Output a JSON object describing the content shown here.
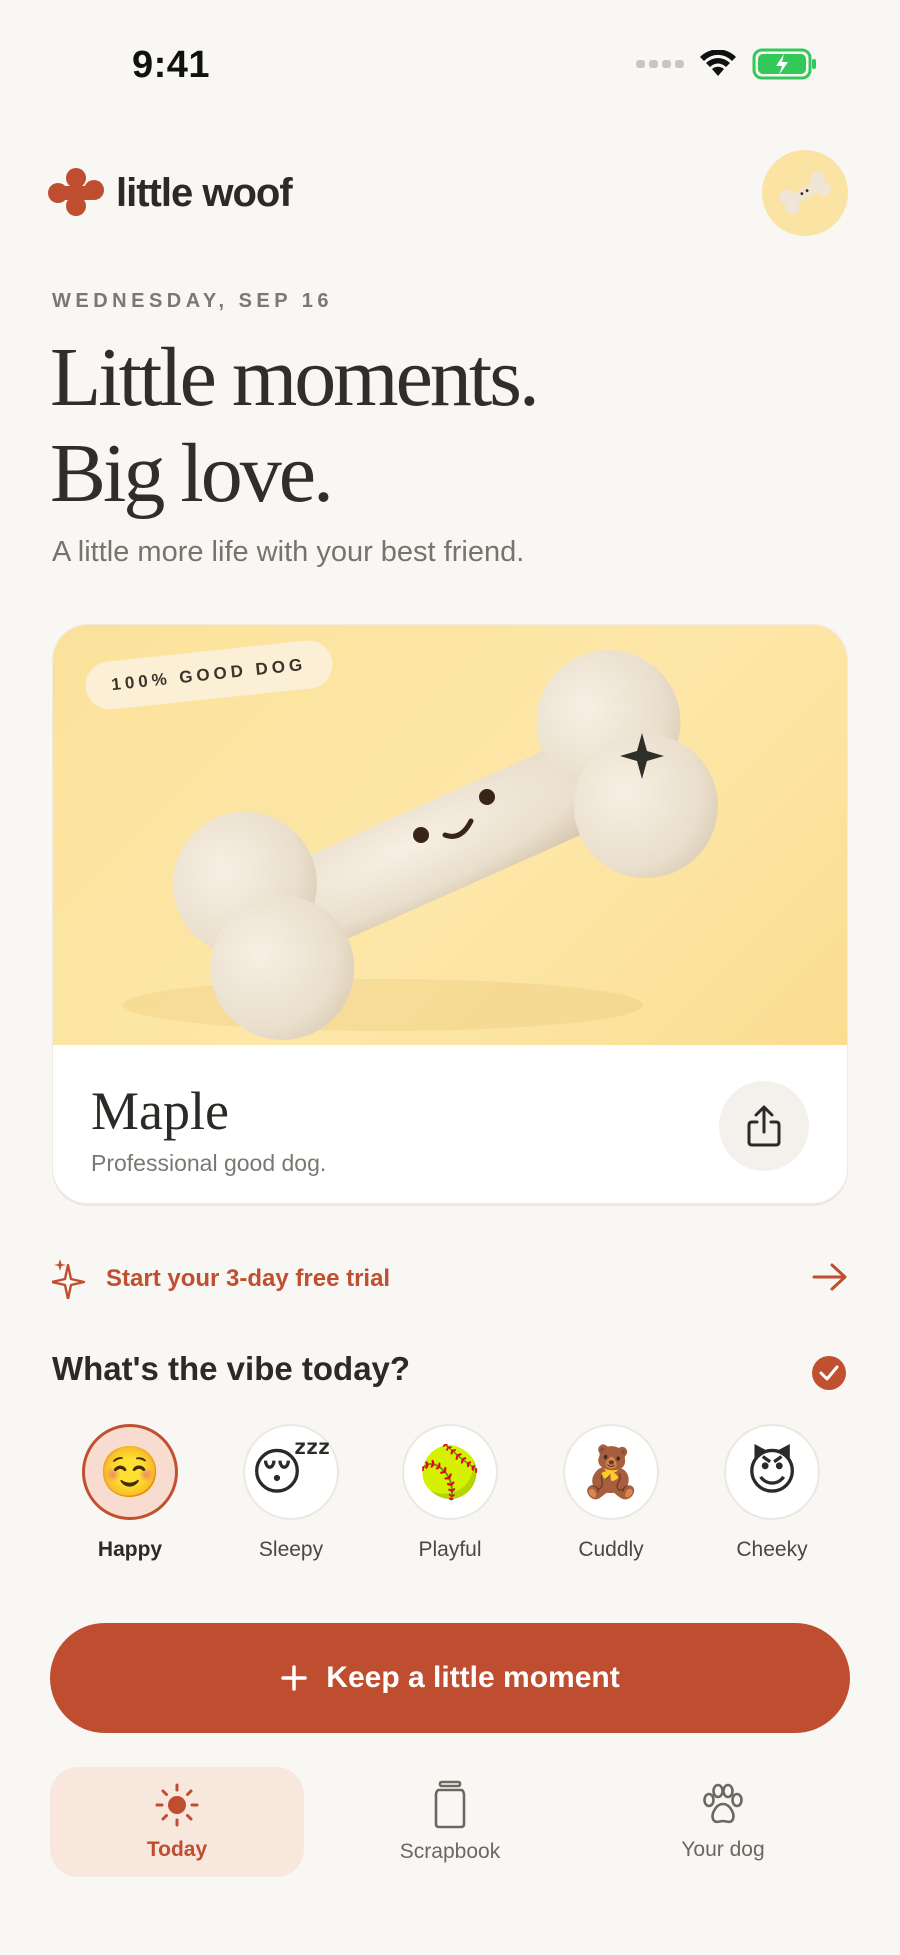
{
  "status_bar": {
    "time": "9:41"
  },
  "brand": {
    "name": "little woof"
  },
  "date": "WEDNESDAY, SEP 16",
  "headline": {
    "line1": "Little moments.",
    "line2": "Big love."
  },
  "subtitle": "A little more life with your best friend.",
  "pet_card": {
    "badge": "100% GOOD DOG",
    "name": "Maple",
    "description": "Professional good dog."
  },
  "trial": {
    "label": "Start your 3-day free trial"
  },
  "vibe": {
    "title": "What's the vibe today?",
    "selected": "Happy",
    "moods": [
      {
        "emoji": "☺️",
        "label": "Happy"
      },
      {
        "emoji": "😴",
        "label": "Sleepy"
      },
      {
        "emoji": "🥎",
        "label": "Playful"
      },
      {
        "emoji": "🧸",
        "label": "Cuddly"
      },
      {
        "emoji": "😈",
        "label": "Cheeky"
      }
    ]
  },
  "cta": {
    "label": "Keep a little moment"
  },
  "tabs": [
    {
      "label": "Today",
      "icon": "sun-icon",
      "active": true
    },
    {
      "label": "Scrapbook",
      "icon": "jar-icon",
      "active": false
    },
    {
      "label": "Your dog",
      "icon": "paw-icon",
      "active": false
    }
  ],
  "colors": {
    "accent": "#bf4e31",
    "background": "#f9f7f3",
    "card_yellow": "#fbe29b"
  }
}
